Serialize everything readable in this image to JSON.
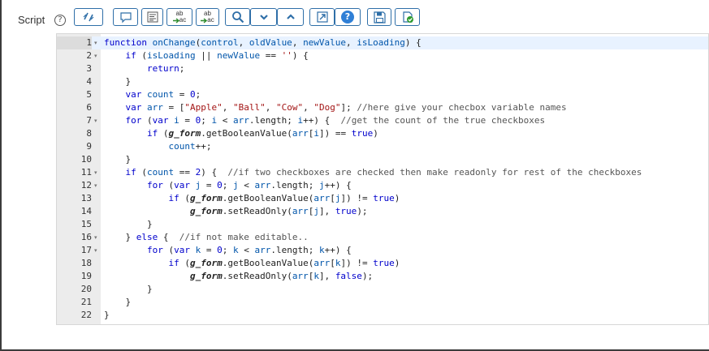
{
  "field": {
    "label": "Script",
    "help_glyph": "?"
  },
  "toolbar": {
    "buttons": [
      {
        "name": "toggle-syntax-button",
        "icon": "toggle-icon"
      },
      {
        "name": "comment-button",
        "icon": "comment-icon"
      },
      {
        "name": "format-code-button",
        "icon": "format-icon"
      },
      {
        "name": "replace-button",
        "icon": "replace-icon",
        "text_top": "ab",
        "text_bottom": "ac"
      },
      {
        "name": "replace-all-button",
        "icon": "replace-all-icon",
        "text_top": "ab",
        "text_bottom": "ac"
      },
      {
        "name": "search-button",
        "icon": "search-icon"
      },
      {
        "name": "find-next-button",
        "icon": "chevron-down-icon"
      },
      {
        "name": "find-previous-button",
        "icon": "chevron-up-icon"
      },
      {
        "name": "fullscreen-button",
        "icon": "expand-icon"
      },
      {
        "name": "help-button",
        "icon": "help-icon",
        "text": "?"
      },
      {
        "name": "save-button",
        "icon": "save-icon"
      },
      {
        "name": "check-syntax-button",
        "icon": "check-syntax-icon"
      }
    ]
  },
  "editor": {
    "active_line": 1,
    "fold_marker": "▾",
    "lines": [
      {
        "n": "1",
        "fold": true,
        "tokens": [
          [
            "kw",
            "function"
          ],
          [
            "t",
            " "
          ],
          [
            "vr",
            "onChange"
          ],
          [
            "t",
            "("
          ],
          [
            "vr",
            "control"
          ],
          [
            "t",
            ", "
          ],
          [
            "vr",
            "oldValue"
          ],
          [
            "t",
            ", "
          ],
          [
            "vr",
            "newValue"
          ],
          [
            "t",
            ", "
          ],
          [
            "vr",
            "isLoading"
          ],
          [
            "t",
            ") {"
          ]
        ]
      },
      {
        "n": "2",
        "fold": true,
        "tokens": [
          [
            "t",
            "    "
          ],
          [
            "kw",
            "if"
          ],
          [
            "t",
            " ("
          ],
          [
            "vr",
            "isLoading"
          ],
          [
            "t",
            " || "
          ],
          [
            "vr",
            "newValue"
          ],
          [
            "t",
            " == "
          ],
          [
            "str",
            "''"
          ],
          [
            "t",
            ") {"
          ]
        ]
      },
      {
        "n": "3",
        "fold": false,
        "tokens": [
          [
            "t",
            "        "
          ],
          [
            "kw",
            "return"
          ],
          [
            "t",
            ";"
          ]
        ]
      },
      {
        "n": "4",
        "fold": false,
        "tokens": [
          [
            "t",
            "    }"
          ]
        ]
      },
      {
        "n": "5",
        "fold": false,
        "tokens": [
          [
            "t",
            "    "
          ],
          [
            "kw",
            "var"
          ],
          [
            "t",
            " "
          ],
          [
            "vr",
            "count"
          ],
          [
            "t",
            " = "
          ],
          [
            "num",
            "0"
          ],
          [
            "t",
            ";"
          ]
        ]
      },
      {
        "n": "6",
        "fold": false,
        "tokens": [
          [
            "t",
            "    "
          ],
          [
            "kw",
            "var"
          ],
          [
            "t",
            " "
          ],
          [
            "vr",
            "arr"
          ],
          [
            "t",
            " = ["
          ],
          [
            "str",
            "\"Apple\""
          ],
          [
            "t",
            ", "
          ],
          [
            "str",
            "\"Ball\""
          ],
          [
            "t",
            ", "
          ],
          [
            "str",
            "\"Cow\""
          ],
          [
            "t",
            ", "
          ],
          [
            "str",
            "\"Dog\""
          ],
          [
            "t",
            "]; "
          ],
          [
            "cmt",
            "//here give your checbox variable names"
          ]
        ]
      },
      {
        "n": "7",
        "fold": true,
        "tokens": [
          [
            "t",
            "    "
          ],
          [
            "kw",
            "for"
          ],
          [
            "t",
            " ("
          ],
          [
            "kw",
            "var"
          ],
          [
            "t",
            " "
          ],
          [
            "vr",
            "i"
          ],
          [
            "t",
            " = "
          ],
          [
            "num",
            "0"
          ],
          [
            "t",
            "; "
          ],
          [
            "vr",
            "i"
          ],
          [
            "t",
            " < "
          ],
          [
            "vr",
            "arr"
          ],
          [
            "t",
            ".length; "
          ],
          [
            "vr",
            "i"
          ],
          [
            "t",
            "++) {  "
          ],
          [
            "cmt",
            "//get the count of the true checkboxes"
          ]
        ]
      },
      {
        "n": "8",
        "fold": false,
        "tokens": [
          [
            "t",
            "        "
          ],
          [
            "kw",
            "if"
          ],
          [
            "t",
            " ("
          ],
          [
            "obj",
            "g_form"
          ],
          [
            "t",
            ".getBooleanValue("
          ],
          [
            "vr",
            "arr"
          ],
          [
            "t",
            "["
          ],
          [
            "vr",
            "i"
          ],
          [
            "t",
            "]) == "
          ],
          [
            "kw",
            "true"
          ],
          [
            "t",
            ")"
          ]
        ]
      },
      {
        "n": "9",
        "fold": false,
        "tokens": [
          [
            "t",
            "            "
          ],
          [
            "vr",
            "count"
          ],
          [
            "t",
            "++;"
          ]
        ]
      },
      {
        "n": "10",
        "fold": false,
        "tokens": [
          [
            "t",
            "    }"
          ]
        ]
      },
      {
        "n": "11",
        "fold": true,
        "tokens": [
          [
            "t",
            "    "
          ],
          [
            "kw",
            "if"
          ],
          [
            "t",
            " ("
          ],
          [
            "vr",
            "count"
          ],
          [
            "t",
            " == "
          ],
          [
            "num",
            "2"
          ],
          [
            "t",
            ") {  "
          ],
          [
            "cmt",
            "//if two checkboxes are checked then make readonly for rest of the checkboxes"
          ]
        ]
      },
      {
        "n": "12",
        "fold": true,
        "tokens": [
          [
            "t",
            "        "
          ],
          [
            "kw",
            "for"
          ],
          [
            "t",
            " ("
          ],
          [
            "kw",
            "var"
          ],
          [
            "t",
            " "
          ],
          [
            "vr",
            "j"
          ],
          [
            "t",
            " = "
          ],
          [
            "num",
            "0"
          ],
          [
            "t",
            "; "
          ],
          [
            "vr",
            "j"
          ],
          [
            "t",
            " < "
          ],
          [
            "vr",
            "arr"
          ],
          [
            "t",
            ".length; "
          ],
          [
            "vr",
            "j"
          ],
          [
            "t",
            "++) {"
          ]
        ]
      },
      {
        "n": "13",
        "fold": false,
        "tokens": [
          [
            "t",
            "            "
          ],
          [
            "kw",
            "if"
          ],
          [
            "t",
            " ("
          ],
          [
            "obj",
            "g_form"
          ],
          [
            "t",
            ".getBooleanValue("
          ],
          [
            "vr",
            "arr"
          ],
          [
            "t",
            "["
          ],
          [
            "vr",
            "j"
          ],
          [
            "t",
            "]) != "
          ],
          [
            "kw",
            "true"
          ],
          [
            "t",
            ")"
          ]
        ]
      },
      {
        "n": "14",
        "fold": false,
        "tokens": [
          [
            "t",
            "                "
          ],
          [
            "obj",
            "g_form"
          ],
          [
            "t",
            ".setReadOnly("
          ],
          [
            "vr",
            "arr"
          ],
          [
            "t",
            "["
          ],
          [
            "vr",
            "j"
          ],
          [
            "t",
            "], "
          ],
          [
            "kw",
            "true"
          ],
          [
            "t",
            ");"
          ]
        ]
      },
      {
        "n": "15",
        "fold": false,
        "tokens": [
          [
            "t",
            "        }"
          ]
        ]
      },
      {
        "n": "16",
        "fold": true,
        "tokens": [
          [
            "t",
            "    } "
          ],
          [
            "kw",
            "else"
          ],
          [
            "t",
            " {  "
          ],
          [
            "cmt",
            "//if not make editable.."
          ]
        ]
      },
      {
        "n": "17",
        "fold": true,
        "tokens": [
          [
            "t",
            "        "
          ],
          [
            "kw",
            "for"
          ],
          [
            "t",
            " ("
          ],
          [
            "kw",
            "var"
          ],
          [
            "t",
            " "
          ],
          [
            "vr",
            "k"
          ],
          [
            "t",
            " = "
          ],
          [
            "num",
            "0"
          ],
          [
            "t",
            "; "
          ],
          [
            "vr",
            "k"
          ],
          [
            "t",
            " < "
          ],
          [
            "vr",
            "arr"
          ],
          [
            "t",
            ".length; "
          ],
          [
            "vr",
            "k"
          ],
          [
            "t",
            "++) {"
          ]
        ]
      },
      {
        "n": "18",
        "fold": false,
        "tokens": [
          [
            "t",
            "            "
          ],
          [
            "kw",
            "if"
          ],
          [
            "t",
            " ("
          ],
          [
            "obj",
            "g_form"
          ],
          [
            "t",
            ".getBooleanValue("
          ],
          [
            "vr",
            "arr"
          ],
          [
            "t",
            "["
          ],
          [
            "vr",
            "k"
          ],
          [
            "t",
            "]) != "
          ],
          [
            "kw",
            "true"
          ],
          [
            "t",
            ")"
          ]
        ]
      },
      {
        "n": "19",
        "fold": false,
        "tokens": [
          [
            "t",
            "                "
          ],
          [
            "obj",
            "g_form"
          ],
          [
            "t",
            ".setReadOnly("
          ],
          [
            "vr",
            "arr"
          ],
          [
            "t",
            "["
          ],
          [
            "vr",
            "k"
          ],
          [
            "t",
            "], "
          ],
          [
            "kw",
            "false"
          ],
          [
            "t",
            ");"
          ]
        ]
      },
      {
        "n": "20",
        "fold": false,
        "tokens": [
          [
            "t",
            "        }"
          ]
        ]
      },
      {
        "n": "21",
        "fold": false,
        "tokens": [
          [
            "t",
            "    }"
          ]
        ]
      },
      {
        "n": "22",
        "fold": false,
        "tokens": [
          [
            "t",
            "}"
          ]
        ]
      }
    ]
  }
}
